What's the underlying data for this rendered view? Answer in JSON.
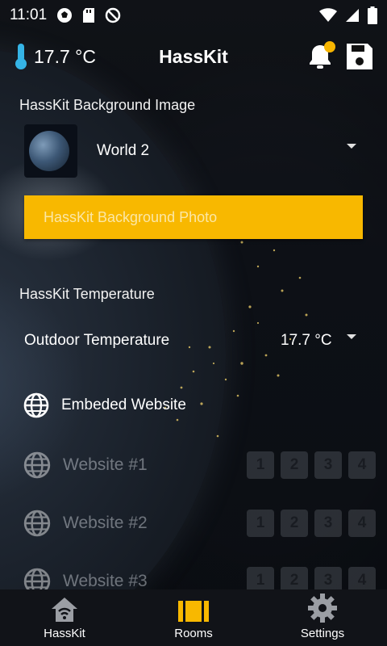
{
  "status_bar": {
    "time": "11:01",
    "left_icons": [
      "soccer-ball-icon",
      "sd-card-icon",
      "do-not-disturb-icon"
    ],
    "right_icons": [
      "wifi-icon",
      "signal-icon",
      "battery-icon"
    ]
  },
  "appbar": {
    "temperature": "17.7 °C",
    "title": "HassKit",
    "icons": [
      "thermometer-icon",
      "bell-icon",
      "save-icon"
    ],
    "accent_color": "#f8b800"
  },
  "background": {
    "section_title": "HassKit Background Image",
    "selected": "World 2",
    "photo_button": "HassKit Background Photo"
  },
  "temperature": {
    "section_title": "HassKit Temperature",
    "label": "Outdoor Temperature",
    "value": "17.7 °C"
  },
  "websites": {
    "header": "Embeded Website",
    "items": [
      {
        "label": "Website #1",
        "buttons": [
          "1",
          "2",
          "3",
          "4"
        ]
      },
      {
        "label": "Website #2",
        "buttons": [
          "1",
          "2",
          "3",
          "4"
        ]
      },
      {
        "label": "Website #3",
        "buttons": [
          "1",
          "2",
          "3",
          "4"
        ]
      }
    ]
  },
  "bottom_nav": {
    "items": [
      {
        "label": "HassKit",
        "icon": "home-wifi-icon"
      },
      {
        "label": "Rooms",
        "icon": "rooms-icon"
      },
      {
        "label": "Settings",
        "icon": "gear-icon"
      }
    ],
    "active": "Settings"
  }
}
